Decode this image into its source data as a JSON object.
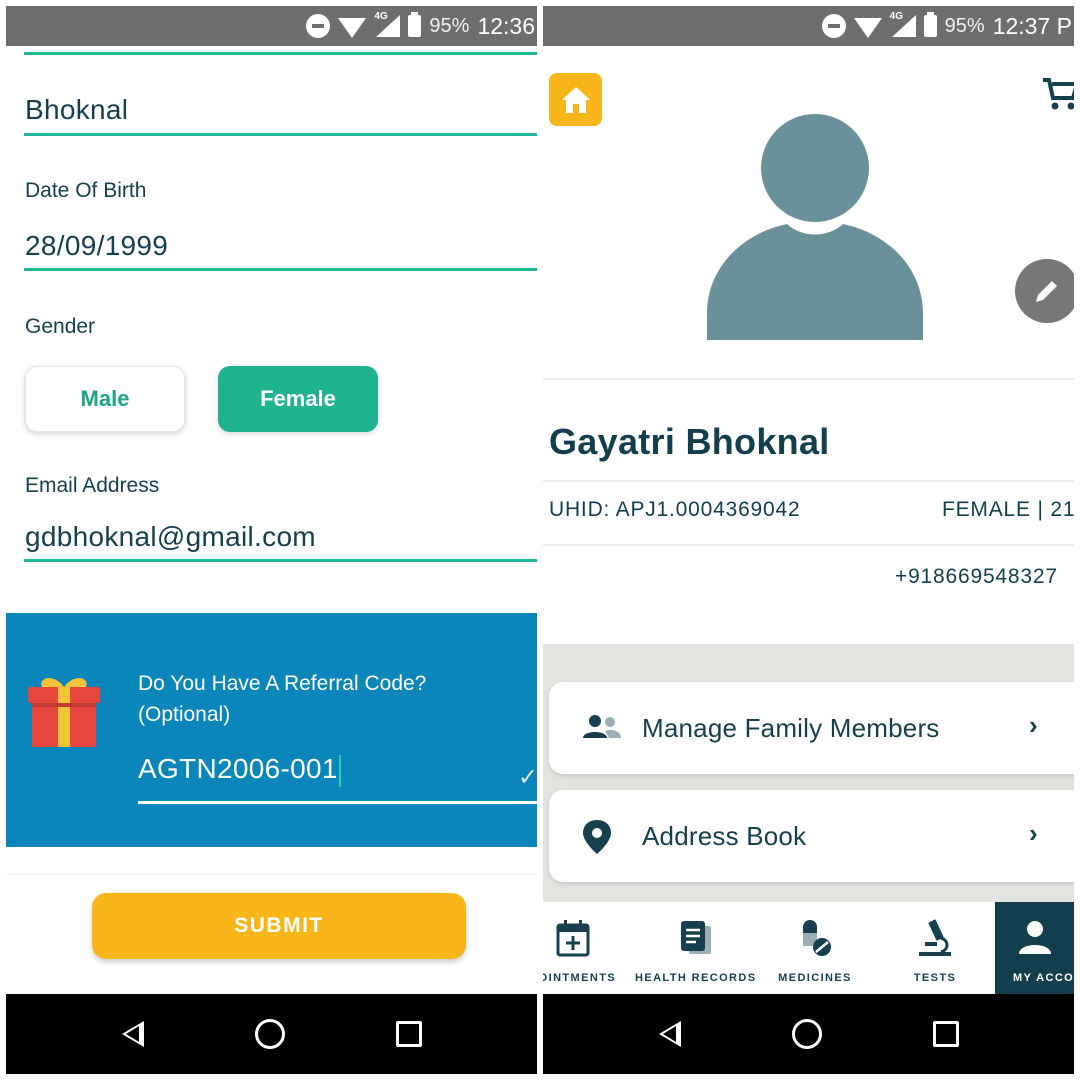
{
  "colors": {
    "teal": "#1fb89a",
    "navy": "#17404f",
    "referral_bg": "#0a86bb",
    "submit": "#f8b61a",
    "avatar": "#6a9099"
  },
  "left_screen": {
    "status_bar": {
      "battery": "95%",
      "time": "12:36",
      "network": "4G"
    },
    "last_name_value": "Bhoknal",
    "dob": {
      "label": "Date Of Birth",
      "value": "28/09/1999"
    },
    "gender": {
      "label": "Gender",
      "male": "Male",
      "female": "Female",
      "selected": "Female"
    },
    "email": {
      "label": "Email Address",
      "value": "gdbhoknal@gmail.com"
    },
    "referral": {
      "question": "Do You Have A Referral Code?",
      "optional": "(Optional)",
      "code": "AGTN2006-001",
      "icon": "gift-icon"
    },
    "submit_label": "SUBMIT"
  },
  "right_screen": {
    "status_bar": {
      "battery": "95%",
      "time": "12:37 P",
      "network": "4G"
    },
    "icons": {
      "home": "home-icon",
      "cart": "cart-icon",
      "edit": "pencil-icon",
      "avatar": "user-avatar-icon"
    },
    "profile": {
      "name": "Gayatri Bhoknal",
      "uhid": "UHID: APJ1.0004369042",
      "gender_age": "FEMALE | 21",
      "phone": "+918669548327"
    },
    "menu": [
      {
        "label": "Manage Family Members",
        "icon": "family-icon"
      },
      {
        "label": "Address Book",
        "icon": "location-pin-icon"
      }
    ],
    "tabs": [
      {
        "label": "POINTMENTS",
        "icon": "calendar-plus-icon"
      },
      {
        "label": "HEALTH RECORDS",
        "icon": "document-icon"
      },
      {
        "label": "MEDICINES",
        "icon": "pills-icon"
      },
      {
        "label": "TESTS",
        "icon": "microscope-icon"
      },
      {
        "label": "MY ACCO",
        "icon": "person-icon",
        "active": true
      }
    ]
  }
}
